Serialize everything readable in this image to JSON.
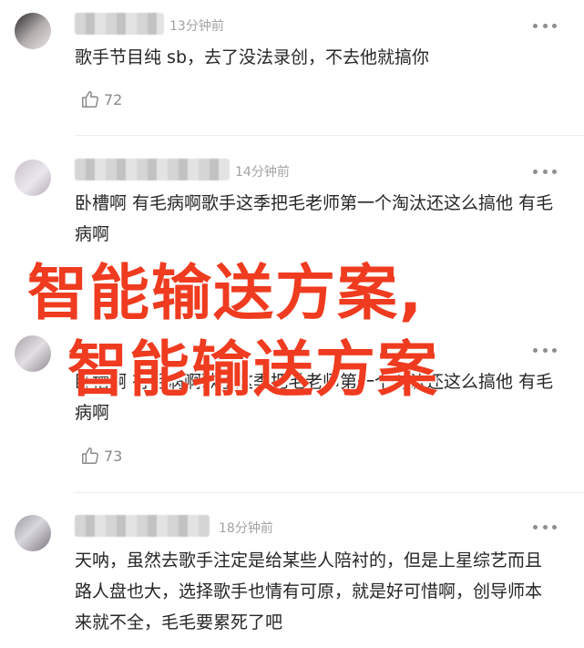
{
  "comments": [
    {
      "time": "13分钟前",
      "text": "歌手节目纯 sb，去了没法录创，不去他就搞你",
      "likes": "72"
    },
    {
      "time": "14分钟前",
      "text": "卧槽啊 有毛病啊歌手这季把毛老师第一个淘汰还这么搞他 有毛病啊",
      "likes": ""
    },
    {
      "time": "",
      "text": "卧槽啊 有毛病啊歌手这季把毛老师第一个淘汰还这么搞他 有毛病啊",
      "likes": "73"
    },
    {
      "time": "18分钟前",
      "text": "天呐，虽然去歌手注定是给某些人陪衬的，但是上星综艺而且路人盘也大，选择歌手也情有可原，就是好可惜啊，创导师本来就不全，毛毛要累死了吧"
    }
  ],
  "overlay": {
    "line1": "智能输送方案,",
    "line2": "智能输送方案",
    "color": "#ef3b1f"
  },
  "icons": {
    "like": "thumbs-up-icon",
    "more": "more-dots-icon"
  }
}
